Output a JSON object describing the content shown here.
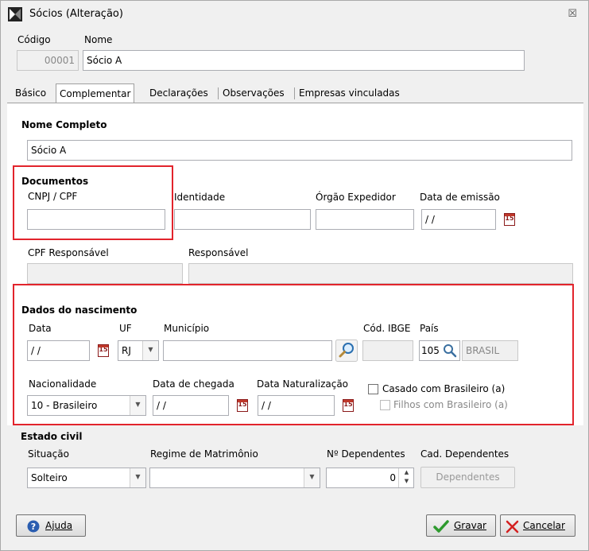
{
  "window": {
    "title": "Sócios (Alteração)",
    "close_glyph": "☒"
  },
  "header": {
    "codigo_label": "Código",
    "codigo_value": "00001",
    "nome_label": "Nome",
    "nome_value": "Sócio A"
  },
  "tabs": [
    {
      "label": "Básico"
    },
    {
      "label": "Complementar"
    },
    {
      "label": "Declarações"
    },
    {
      "label": "Observações"
    },
    {
      "label": "Empresas vinculadas"
    }
  ],
  "nome_completo": {
    "label": "Nome Completo",
    "value": "Sócio A"
  },
  "documentos": {
    "section_label": "Documentos",
    "cnpj_label": "CNPJ / CPF",
    "cnpj_value": "",
    "identidade_label": "Identidade",
    "identidade_value": "",
    "orgao_label": "Órgão Expedidor",
    "orgao_value": "",
    "data_emissao_label": "Data de emissão",
    "data_emissao_value": " / /",
    "cpf_resp_label": "CPF Responsável",
    "responsavel_label": "Responsável"
  },
  "nascimento": {
    "section_label": "Dados do nascimento",
    "data_label": "Data",
    "data_value": " / /",
    "uf_label": "UF",
    "uf_value": "RJ",
    "municipio_label": "Município",
    "municipio_value": "",
    "cod_ibge_label": "Cód. IBGE",
    "pais_label": "País",
    "pais_code": "105",
    "pais_name": "BRASIL",
    "nacionalidade_label": "Nacionalidade",
    "nacionalidade_value": "10 - Brasileiro",
    "data_chegada_label": "Data de chegada",
    "data_chegada_value": " / /",
    "data_nat_label": "Data Naturalização",
    "data_nat_value": " / /",
    "casado_label": "Casado com Brasileiro (a)",
    "filhos_label": "Filhos com Brasileiro (a)"
  },
  "estado_civil": {
    "section_label": "Estado civil",
    "situacao_label": "Situação",
    "situacao_value": "Solteiro",
    "regime_label": "Regime de Matrimônio",
    "regime_value": "",
    "dependentes_label": "Nº Dependentes",
    "dependentes_value": "0",
    "cad_dep_label": "Cad. Dependentes",
    "cad_dep_button": "Dependentes"
  },
  "footer": {
    "ajuda": "Ajuda",
    "gravar": "Gravar",
    "cancelar": "Cancelar"
  },
  "colors": {
    "highlight_box": "#e2242c",
    "ok_check": "#2e9a2e",
    "cancel_x": "#d42020",
    "help_icon": "#2a5db0"
  }
}
